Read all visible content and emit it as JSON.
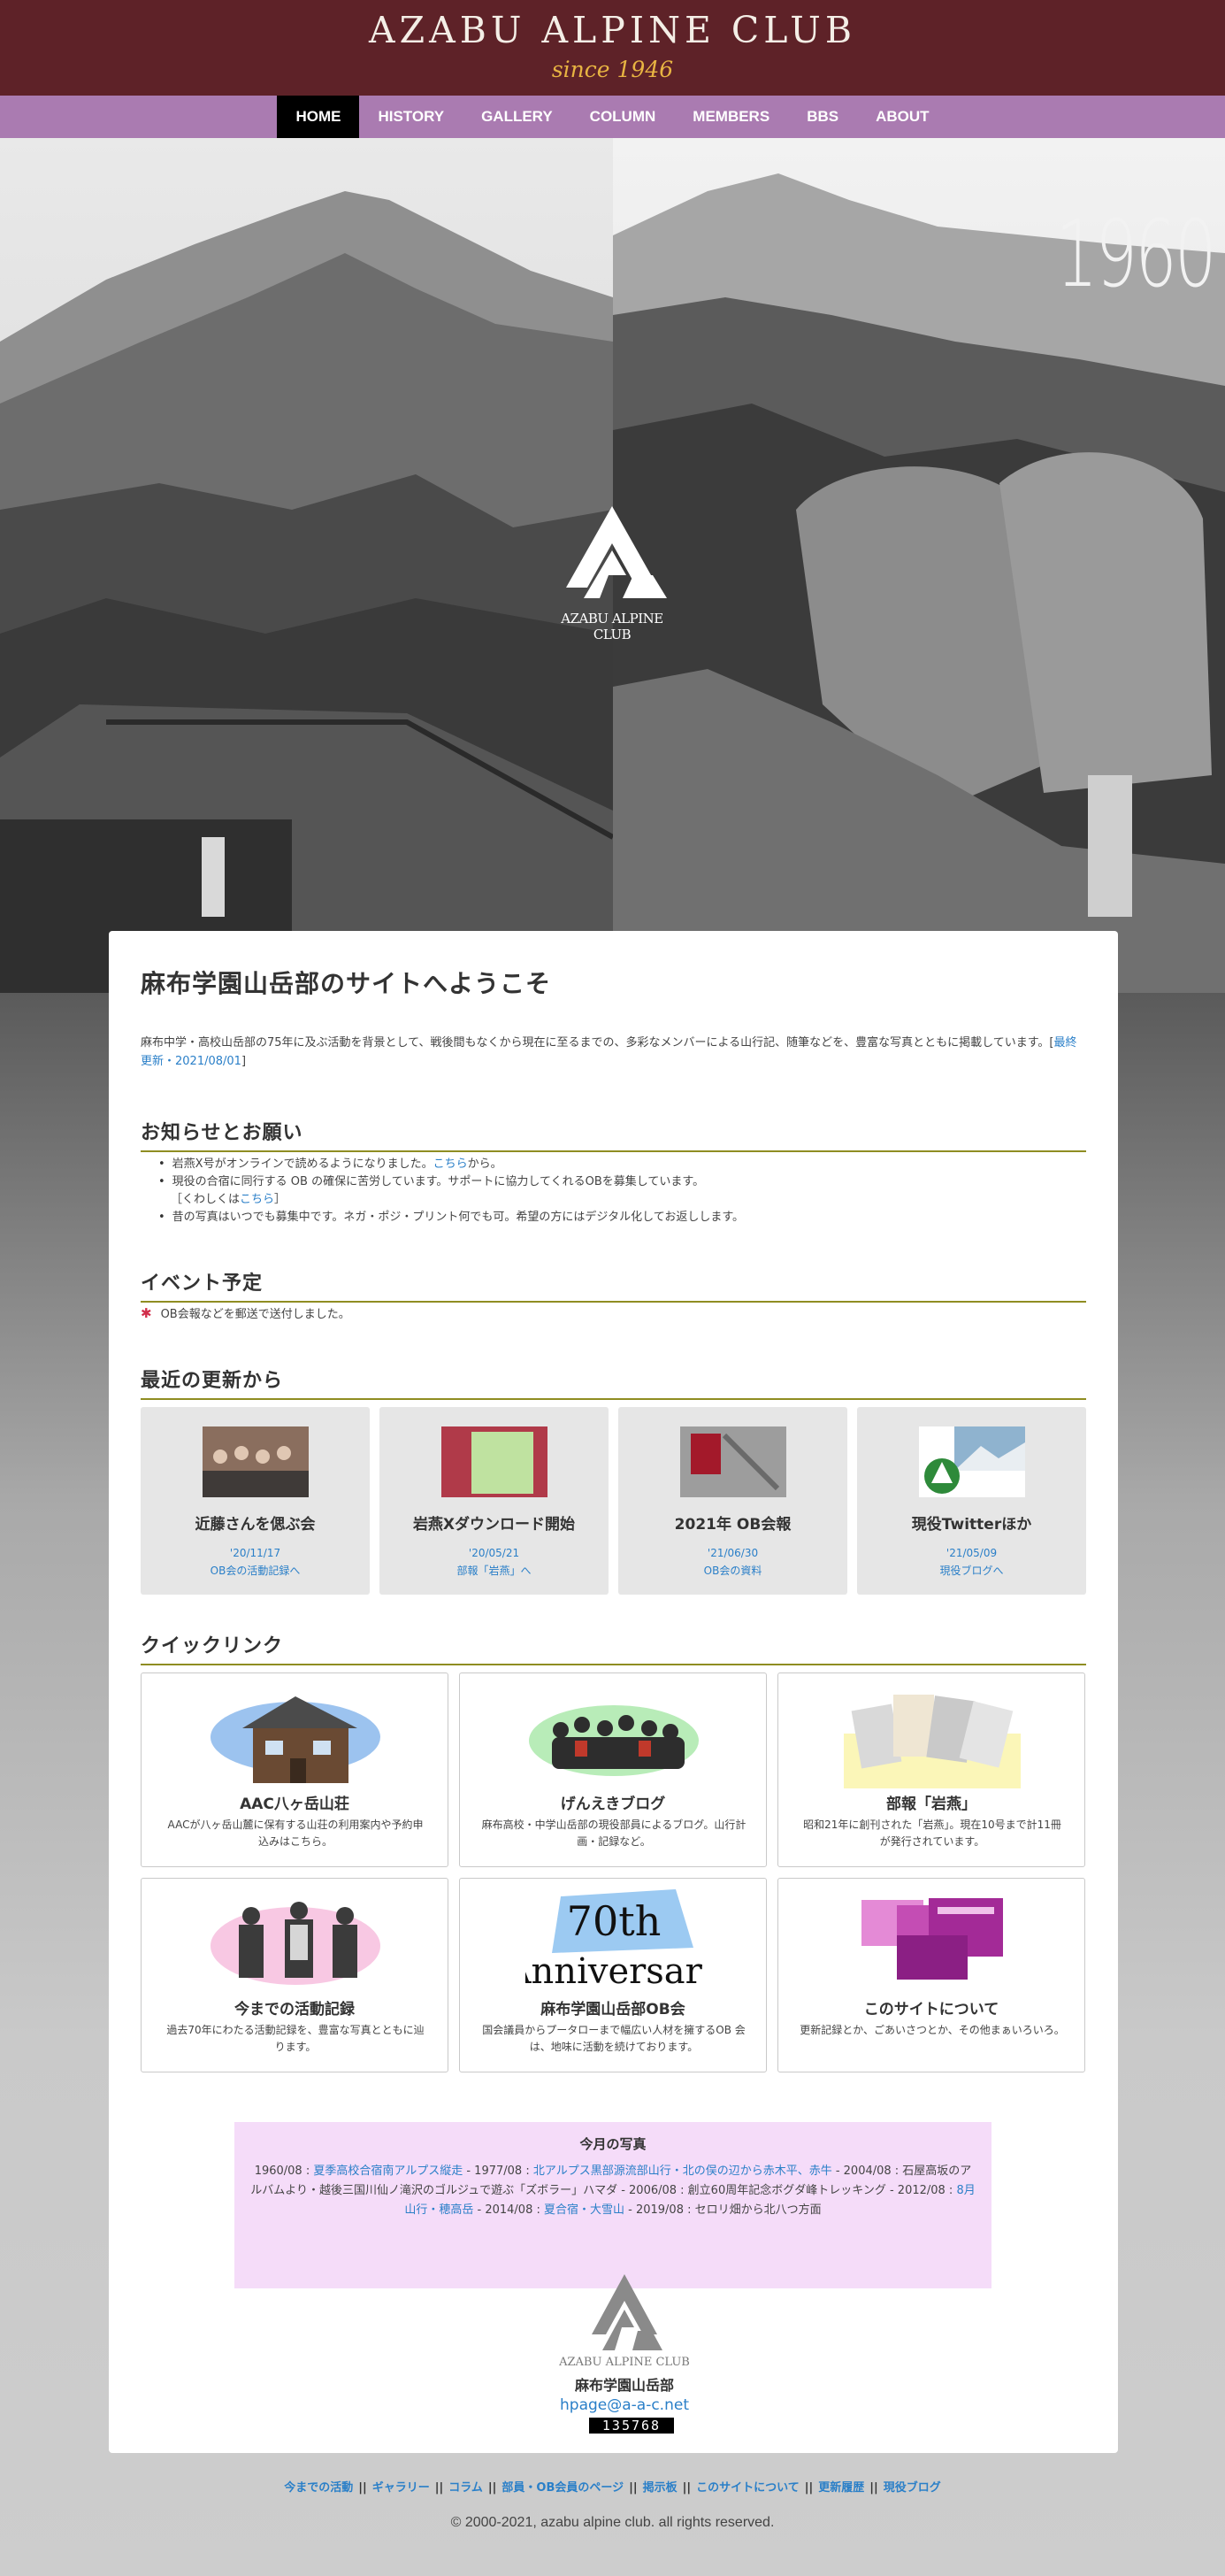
{
  "header": {
    "title": "AZABU ALPINE CLUB",
    "subtitle": "since 1946"
  },
  "nav": {
    "items": [
      "HOME",
      "HISTORY",
      "GALLERY",
      "COLUMN",
      "MEMBERS",
      "BBS",
      "ABOUT"
    ],
    "active": "HOME"
  },
  "hero": {
    "year": "1960",
    "logo_text": "AZABU ALPINE CLUB"
  },
  "welcome": {
    "title": "麻布学園山岳部のサイトへようこそ",
    "intro": "麻布中学・高校山岳部の75年に及ぶ活動を背景として、戦後間もなくから現在に至るまでの、多彩なメンバーによる山行記、随筆などを、豊富な写真とともに掲載しています。[",
    "last_update_link": "最終更新・2021/08/01",
    "intro_end": "]"
  },
  "notice": {
    "heading": "お知らせとお願い",
    "item1_before": "岩燕X号がオンラインで読めるようになりました。",
    "item1_link": "こちら",
    "item1_after": "から。",
    "item2": "現役の合宿に同行する OB の確保に苦労しています。サポートに協力してくれるOBを募集しています。",
    "item2_sub_before": "［くわしくは",
    "item2_sub_link": "こちら",
    "item2_sub_after": "］",
    "item3": "昔の写真はいつでも募集中です。ネガ・ポジ・プリント何でも可。希望の方にはデジタル化してお返しします。"
  },
  "events": {
    "heading": "イベント予定",
    "item": "OB会報などを郵送で送付しました。"
  },
  "updates": {
    "heading": "最近の更新から",
    "cards": [
      {
        "title": "近藤さんを偲ぶ会",
        "date": "'20/11/17",
        "link": "OB会の活動記録へ"
      },
      {
        "title": "岩燕Xダウンロード開始",
        "date": "'20/05/21",
        "link": "部報「岩燕」へ"
      },
      {
        "title": "2021年 OB会報",
        "date": "'21/06/30",
        "link": "OB会の資料"
      },
      {
        "title": "現役Twitterほか",
        "date": "'21/05/09",
        "link": "現役ブログへ"
      }
    ]
  },
  "quicklinks": {
    "heading": "クイックリンク",
    "cards": [
      {
        "title": "AAC八ヶ岳山荘",
        "desc": "AACが八ヶ岳山麓に保有する山荘の利用案内や予約申込みはこちら。"
      },
      {
        "title": "げんえきブログ",
        "desc": "麻布高校・中学山岳部の現役部員によるブログ。山行計画・記録など。"
      },
      {
        "title": "部報「岩燕」",
        "desc": "昭和21年に創刊された「岩燕」。現在10号まで計11冊が発行されています。"
      },
      {
        "title": "今までの活動記録",
        "desc": "過去70年にわたる活動記録を、豊富な写真とともに辿ります。"
      },
      {
        "title": "麻布学園山岳部OB会",
        "desc": "国会議員からプータローまで幅広い人材を擁するOB 会は、地味に活動を続けております。"
      },
      {
        "title": "このサイトについて",
        "desc": "更新記録とか、ごあいさつとか、その他まぁいろいろ。"
      }
    ],
    "anniversary_top": "70th",
    "anniversary_bottom": "Anniversary"
  },
  "photos": {
    "title": "今月の写真",
    "p1": "1960/08 : ",
    "l1": "夏季高校合宿南アルプス縦走",
    "p2": " - 1977/08 : ",
    "l2": "北アルプス黒部源流部山行・北の俣の辺から赤木平、赤牛",
    "p3": " - 2004/08 : 石屋高坂のアルバムより・越後三国川仙ノ滝沢のゴルジュで遊ぶ「ズボラー」ハマダ - 2006/08 : 創立60周年記念ボグダ峰トレッキング - 2012/08 : ",
    "l3": "8月山行・穂高岳",
    "p4": " - 2014/08 : ",
    "l4": "夏合宿・大雪山",
    "p5": " - 2019/08 : セロリ畑から北八つ方面"
  },
  "footer_logo": {
    "logo_text": "AZABU ALPINE CLUB",
    "name": "麻布学園山岳部",
    "email": "hpage@a-a-c.net",
    "counter": "135768"
  },
  "footer": {
    "links": [
      "今までの活動",
      "ギャラリー",
      "コラム",
      "部員・OB会員のページ",
      "掲示板",
      "このサイトについて",
      "更新履歴",
      "現役ブログ"
    ],
    "separator": "||",
    "copyright": "© 2000-2021, azabu alpine club. all rights reserved."
  },
  "colors": {
    "header_bg": "#5e2228",
    "nav_bg": "#aa7bb1",
    "subtitle": "#e8b442",
    "link": "#2a7fc8",
    "heading_rule": "#8f8d22",
    "photo_box_bg": "#f5dcf9"
  },
  "icons": [
    "aac-logo-icon",
    "asterisk-icon"
  ]
}
